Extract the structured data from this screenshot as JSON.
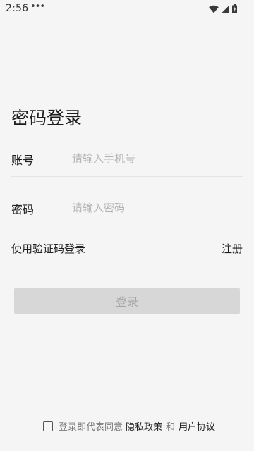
{
  "status_bar": {
    "time": "2:56",
    "dots": "•••"
  },
  "page": {
    "title": "密码登录"
  },
  "form": {
    "account": {
      "label": "账号",
      "placeholder": "请输入手机号",
      "value": ""
    },
    "password": {
      "label": "密码",
      "placeholder": "请输入密码",
      "value": ""
    }
  },
  "links": {
    "sms_login": "使用验证码登录",
    "register": "注册"
  },
  "login_button": {
    "label": "登录",
    "enabled": false
  },
  "agreement": {
    "checked": false,
    "prefix": "登录即代表同意",
    "privacy_policy": "隐私政策",
    "conjunction": "和",
    "user_agreement": "用户协议"
  },
  "icons": {
    "wifi": "wifi-icon",
    "signal": "signal-icon",
    "battery": "battery-icon"
  }
}
